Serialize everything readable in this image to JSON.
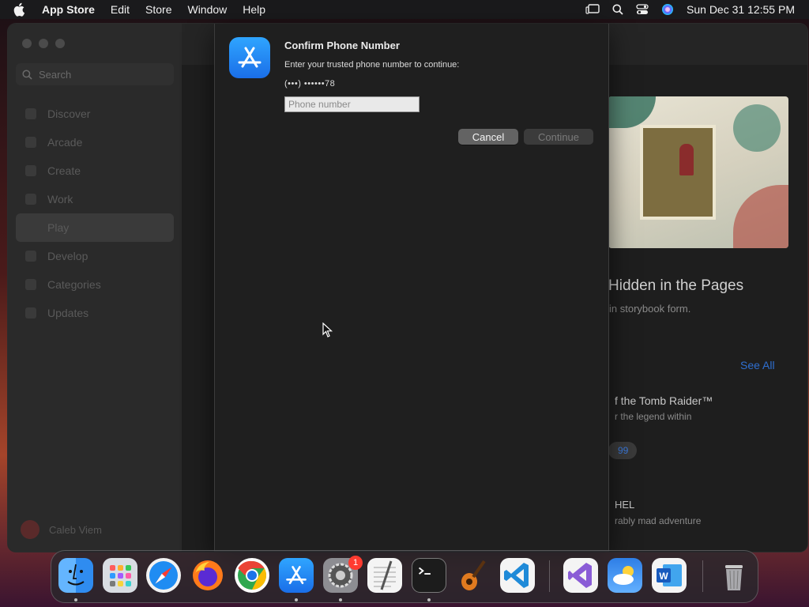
{
  "menubar": {
    "app_name": "App Store",
    "menus": [
      "Edit",
      "Store",
      "Window",
      "Help"
    ],
    "clock": "Sun Dec 31  12:55 PM"
  },
  "sidebar": {
    "search_placeholder": "Search",
    "items": [
      {
        "label": "Discover"
      },
      {
        "label": "Arcade"
      },
      {
        "label": "Create"
      },
      {
        "label": "Work"
      },
      {
        "label": "Play"
      },
      {
        "label": "Develop"
      },
      {
        "label": "Categories"
      },
      {
        "label": "Updates"
      }
    ],
    "user_name": "Caleb Viem"
  },
  "content": {
    "hero_title": "Hidden in the Pages",
    "hero_subtitle": "in storybook form.",
    "see_all": "See All",
    "game1_title": "f the Tomb Raider™",
    "game1_subtitle": "r the legend within",
    "price_fragment": "99",
    "game2_title": "HEL",
    "game2_subtitle": "rably mad adventure"
  },
  "dialog": {
    "title": "Confirm Phone Number",
    "message": "Enter your trusted phone number to continue:",
    "masked_number": "(•••) ••••••78",
    "input_placeholder": "Phone number",
    "input_value": "",
    "cancel_label": "Cancel",
    "continue_label": "Continue"
  },
  "dock": {
    "apps": [
      "finder",
      "launchpad",
      "safari",
      "firefox",
      "chrome",
      "app-store",
      "system-settings",
      "textedit",
      "terminal",
      "garageband",
      "vscode",
      "visual-studio",
      "weather",
      "word",
      "trash"
    ],
    "settings_badge": "1"
  },
  "colors": {
    "accent_blue": "#1a6ee8",
    "badge_red": "#ff3b30"
  }
}
